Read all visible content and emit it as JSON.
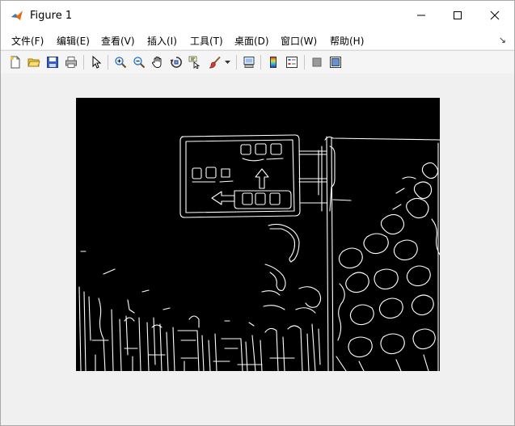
{
  "window": {
    "title": "Figure 1",
    "minimize_glyph": "—",
    "maximize_glyph": "☐",
    "close_glyph": "✕"
  },
  "menu": {
    "items": [
      {
        "label": "文件(F)"
      },
      {
        "label": "编辑(E)"
      },
      {
        "label": "查看(V)"
      },
      {
        "label": "插入(I)"
      },
      {
        "label": "工具(T)"
      },
      {
        "label": "桌面(D)"
      },
      {
        "label": "窗口(W)"
      },
      {
        "label": "帮助(H)"
      }
    ],
    "dock_glyph": "↘"
  },
  "toolbar": {
    "tools": [
      {
        "name": "new-figure-icon"
      },
      {
        "name": "open-file-icon"
      },
      {
        "name": "save-icon"
      },
      {
        "name": "print-icon"
      },
      {
        "name": "edit-plot-arrow-icon"
      },
      {
        "name": "zoom-in-icon"
      },
      {
        "name": "zoom-out-icon"
      },
      {
        "name": "pan-hand-icon"
      },
      {
        "name": "rotate-3d-icon"
      },
      {
        "name": "data-cursor-icon"
      },
      {
        "name": "brush-icon"
      },
      {
        "name": "link-plot-icon"
      },
      {
        "name": "colorbar-icon"
      },
      {
        "name": "legend-icon"
      },
      {
        "name": "hide-plot-tools-icon"
      },
      {
        "name": "show-plot-tools-icon"
      }
    ]
  },
  "colors": {
    "accent": "#0078d7",
    "image_background": "#000000",
    "edge_lines": "#ffffff"
  },
  "figure": {
    "content": "edge-detected image of a road sign with arrows and vegetation"
  }
}
